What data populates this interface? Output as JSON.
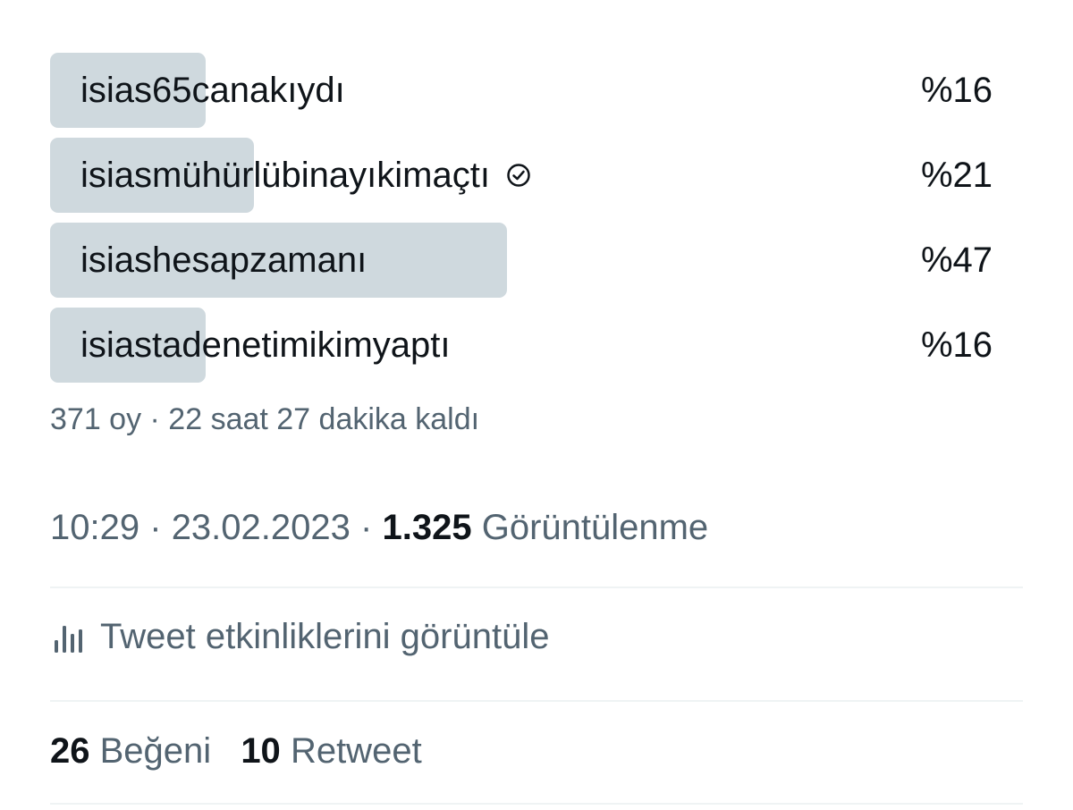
{
  "poll": {
    "options": [
      {
        "label": "isias65canakıydı",
        "percent": "%16",
        "fraction": 0.16,
        "verified": false
      },
      {
        "label": "isiasmühürlübinayıkimaçtı",
        "percent": "%21",
        "fraction": 0.21,
        "verified": true
      },
      {
        "label": "isiashesapzamanı",
        "percent": "%47",
        "fraction": 0.47,
        "verified": false
      },
      {
        "label": "isiastadenetimikimyaptı",
        "percent": "%16",
        "fraction": 0.16,
        "verified": false
      }
    ],
    "meta": "371 oy · 22 saat 27 dakika kaldı",
    "bar_color": "#cfd9de"
  },
  "tweet": {
    "time": "10:29",
    "date": "23.02.2023",
    "separator": "·",
    "views_count": "1.325",
    "views_label": "Görüntülenme"
  },
  "activity": {
    "label": "Tweet etkinliklerini görüntüle",
    "icon": "bar-chart-icon"
  },
  "stats": {
    "likes_count": "26",
    "likes_label": "Beğeni",
    "retweets_count": "10",
    "retweets_label": "Retweet"
  },
  "colors": {
    "text_primary": "#0f1419",
    "text_secondary": "#536471",
    "divider": "#eff3f4"
  }
}
